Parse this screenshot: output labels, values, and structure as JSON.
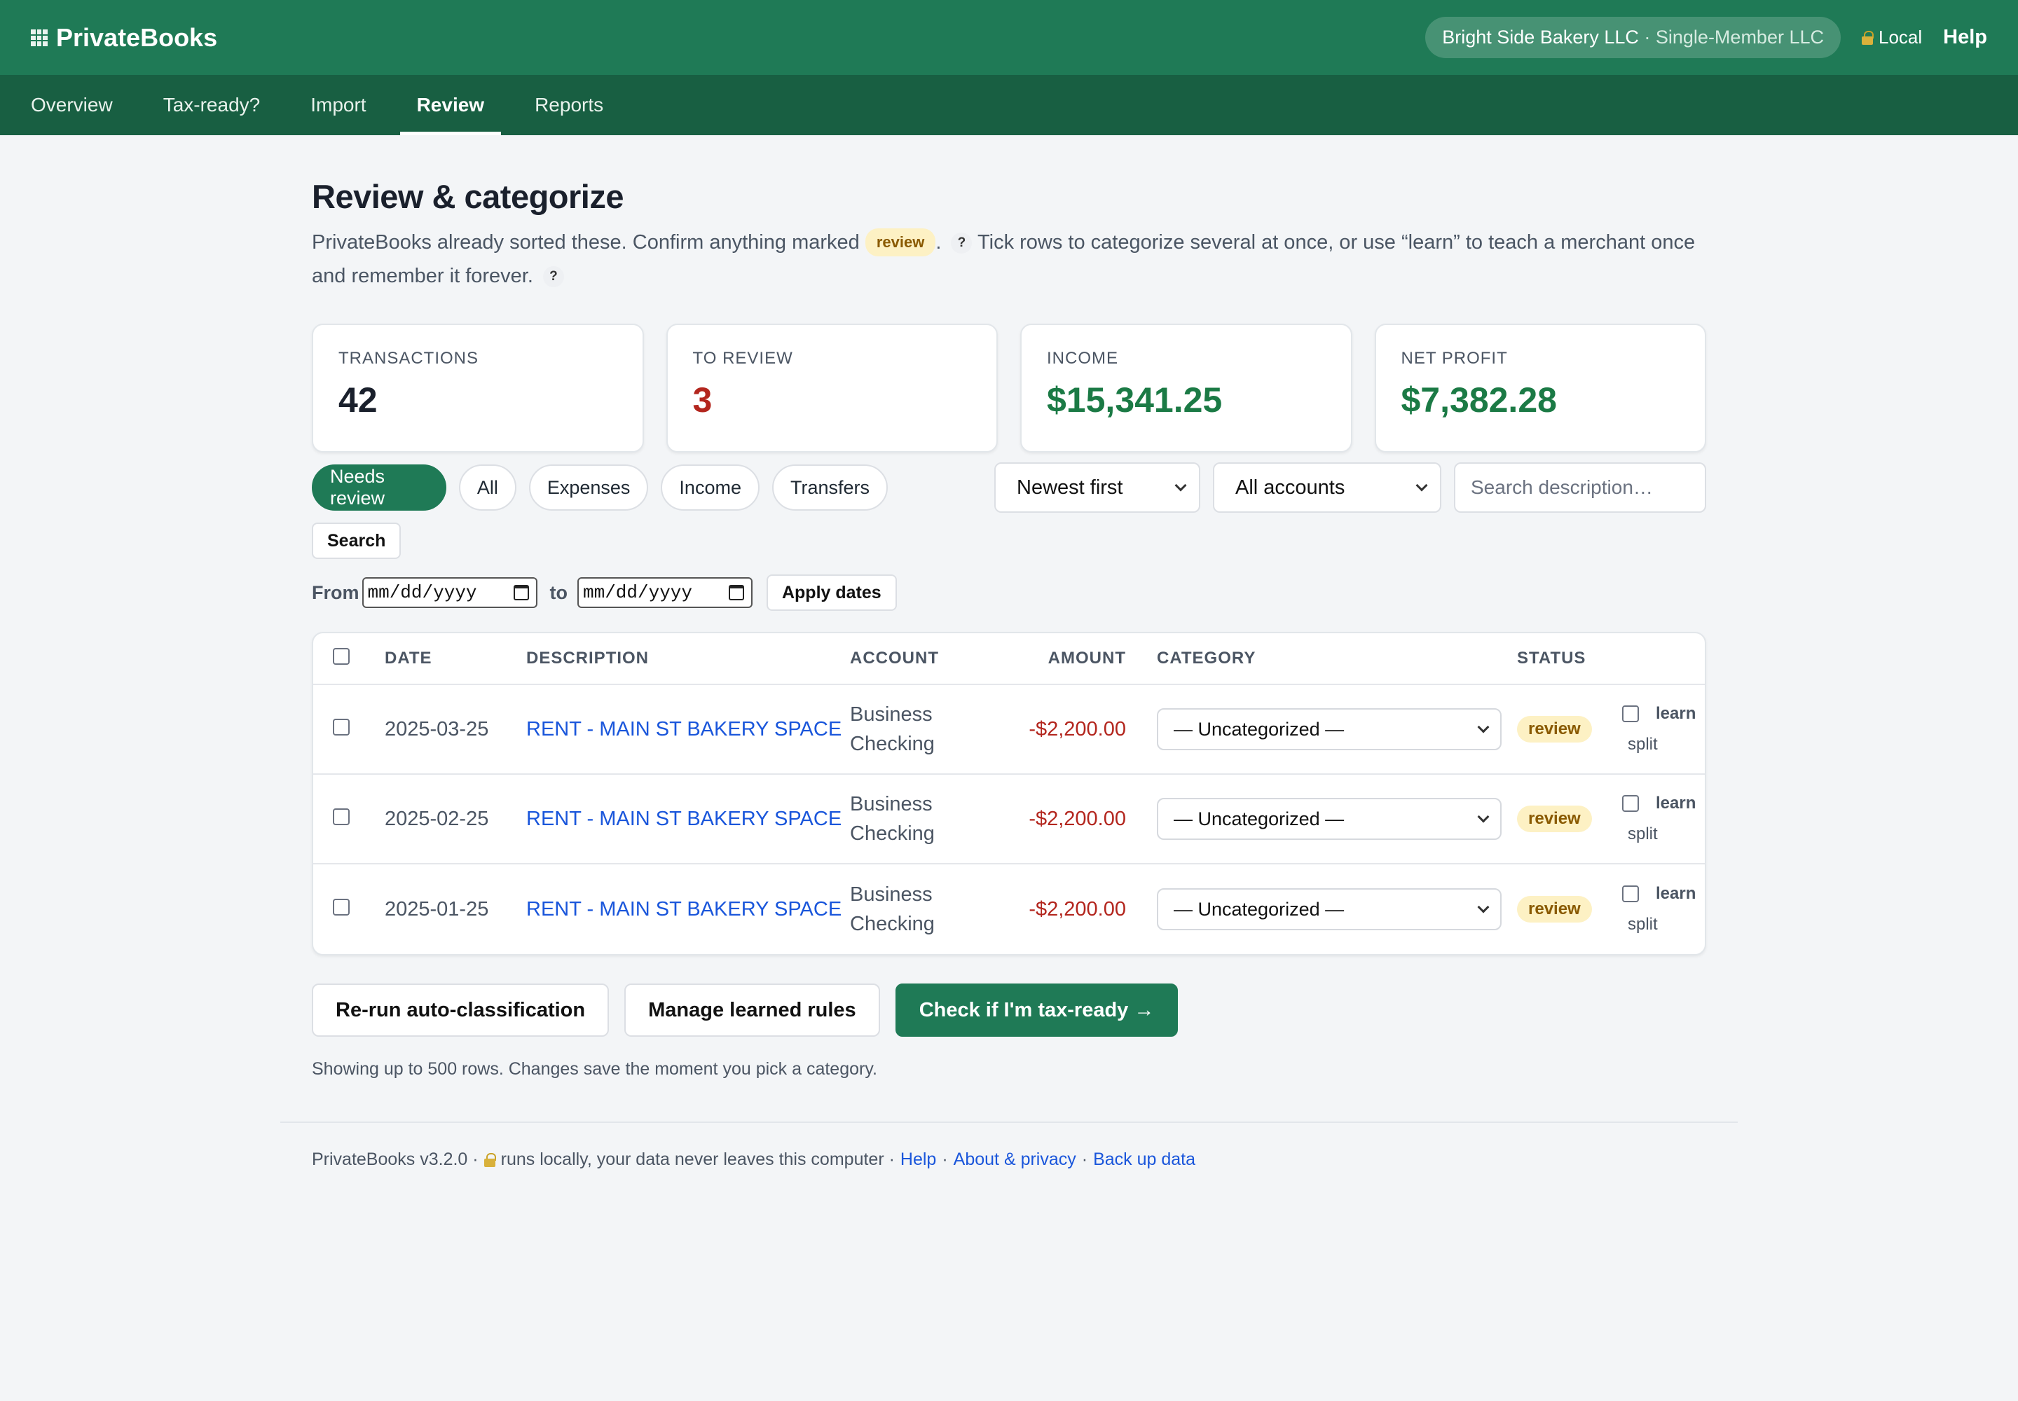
{
  "app": {
    "name": "PrivateBooks",
    "company": "Bright Side Bakery LLC",
    "company_sep": " · ",
    "entity_type": "Single-Member LLC",
    "mode": "Local",
    "help": "Help"
  },
  "nav": {
    "tabs": [
      {
        "label": "Overview"
      },
      {
        "label": "Tax-ready?"
      },
      {
        "label": "Import"
      },
      {
        "label": "Review",
        "active": true
      },
      {
        "label": "Reports"
      }
    ]
  },
  "page": {
    "title": "Review & categorize",
    "intro_part1": "PrivateBooks already sorted these. Confirm anything marked",
    "intro_chip": "review",
    "intro_part2": ". ",
    "intro_part3": " Tick rows to categorize several at once, or use “learn” to teach a merchant once and remember it forever. ",
    "help_glyph": "?"
  },
  "stats": [
    {
      "label": "TRANSACTIONS",
      "value": "42",
      "color": "#1a202c"
    },
    {
      "label": "TO REVIEW",
      "value": "3",
      "color": "#b3261e"
    },
    {
      "label": "INCOME",
      "value": "$15,341.25",
      "color": "#1b7a45"
    },
    {
      "label": "NET PROFIT",
      "value": "$7,382.28",
      "color": "#1b7a45"
    }
  ],
  "filters": {
    "pills": [
      {
        "label": "Needs review",
        "active": true
      },
      {
        "label": "All"
      },
      {
        "label": "Expenses"
      },
      {
        "label": "Income"
      },
      {
        "label": "Transfers"
      }
    ],
    "sort": "Newest first",
    "account": "All accounts",
    "search_placeholder": "Search description…",
    "search_button": "Search",
    "from_label": "From",
    "to_label": "to",
    "date_placeholder": "mm/dd/yyyy",
    "apply_dates": "Apply dates"
  },
  "table": {
    "headers": {
      "date": "DATE",
      "description": "DESCRIPTION",
      "account": "ACCOUNT",
      "amount": "AMOUNT",
      "category": "CATEGORY",
      "status": "STATUS"
    },
    "rows": [
      {
        "date": "2025-03-25",
        "description": "RENT - MAIN ST BAKERY SPACE",
        "account_line1": "Business",
        "account_line2": "Checking",
        "amount": "-$2,200.00",
        "category": "— Uncategorized —",
        "status": "review",
        "learn": "learn",
        "split": "split"
      },
      {
        "date": "2025-02-25",
        "description": "RENT - MAIN ST BAKERY SPACE",
        "account_line1": "Business",
        "account_line2": "Checking",
        "amount": "-$2,200.00",
        "category": "— Uncategorized —",
        "status": "review",
        "learn": "learn",
        "split": "split"
      },
      {
        "date": "2025-01-25",
        "description": "RENT - MAIN ST BAKERY SPACE",
        "account_line1": "Business",
        "account_line2": "Checking",
        "amount": "-$2,200.00",
        "category": "— Uncategorized —",
        "status": "review",
        "learn": "learn",
        "split": "split"
      }
    ]
  },
  "actions": {
    "rerun": "Re-run auto-classification",
    "manage_rules": "Manage learned rules",
    "check_tax": "Check if I'm tax-ready →"
  },
  "note": "Showing up to 500 rows. Changes save the moment you pick a category.",
  "footer": {
    "version": "PrivateBooks v3.2.0 ·",
    "privacy_note": "runs locally, your data never leaves this computer ·",
    "links": [
      {
        "label": "Help"
      },
      {
        "label": "About & privacy"
      },
      {
        "label": "Back up data"
      }
    ],
    "sep": "·"
  },
  "colors": {
    "brand": "#1f7a56",
    "nav": "#185f42",
    "link": "#1a56db",
    "negative": "#b3261e",
    "positive": "#1b7a45",
    "review_badge_bg": "#fdf1c4"
  }
}
